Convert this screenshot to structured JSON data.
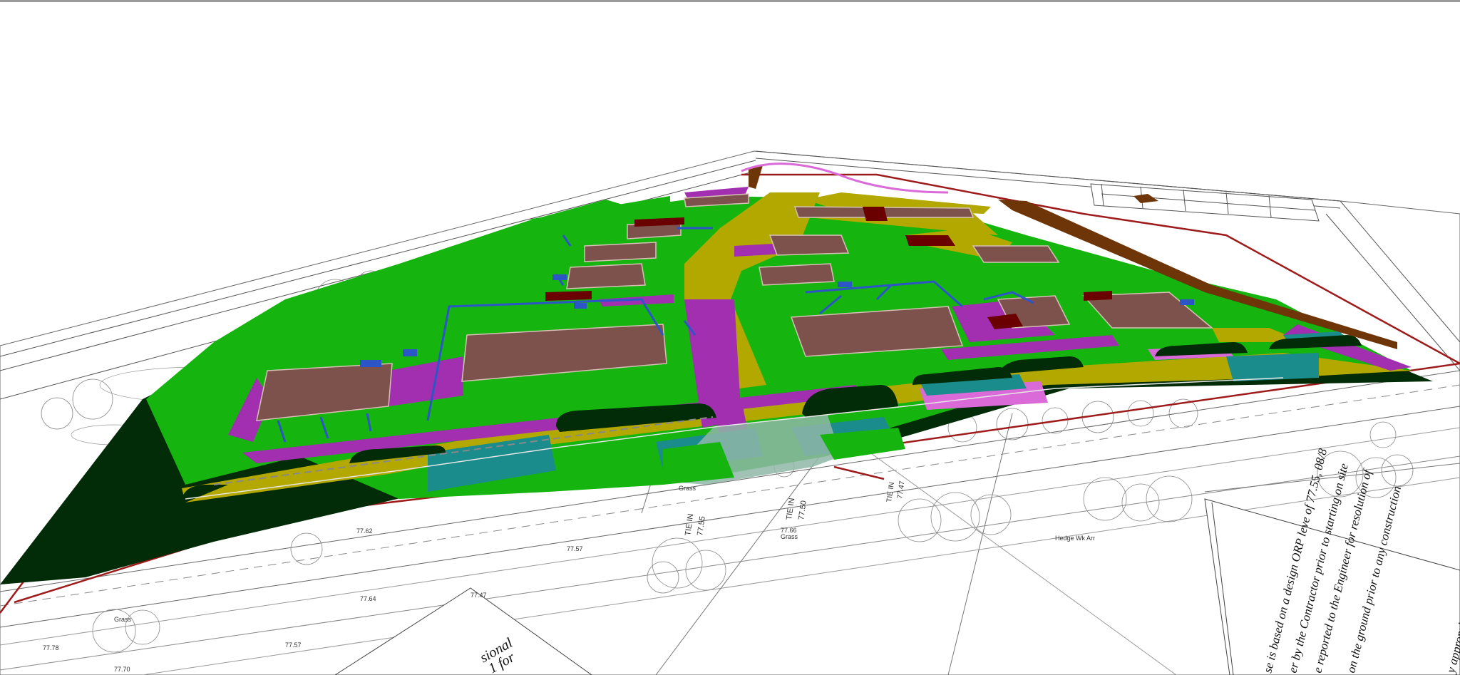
{
  "colors": {
    "background": "#ffffff",
    "linework": "#444444",
    "boundary_red": "#9e1b1b",
    "dark_green": "#022b07",
    "green": "#15b40f",
    "olive": "#b3a800",
    "magenta": "#a22fb0",
    "pink": "#d96ad8",
    "teal": "#1b8c8c",
    "building": "#7d524c",
    "dark_red": "#6b0000",
    "blue": "#2c55c8",
    "brown": "#6e3508",
    "light_teal": "#8fb7a7"
  },
  "drawing_labels": {
    "tie_in_1": "TIE IN",
    "tie_in_1_level": "77.55",
    "tie_in_2": "TIE IN",
    "tie_in_2_level": "77.50",
    "tie_in_3": "TIE IN",
    "tie_in_3_level": "77.47",
    "level_1": "77.57",
    "level_2": "77.64",
    "level_3": "77.47",
    "level_4": "77.78",
    "level_5": "77.57",
    "level_6": "77.70",
    "level_7": "77.62",
    "level_8": "77.66",
    "grass_1": "Grass",
    "grass_2": "Grass",
    "grass_3": "Grass",
    "hedge": "Hedge Wk Arr"
  },
  "notes": {
    "box_line_1": "sional",
    "box_line_2": "1 for",
    "right_line_1": "se is based on a design ORP leve of 77.55, 08/8",
    "right_line_2": "er by the Contractor prior to starting on site",
    "right_line_3": "e reported to the Engineer for resolution of",
    "right_line_4": "on the ground prior to any construction",
    "right_line_5": "y appropriate"
  }
}
